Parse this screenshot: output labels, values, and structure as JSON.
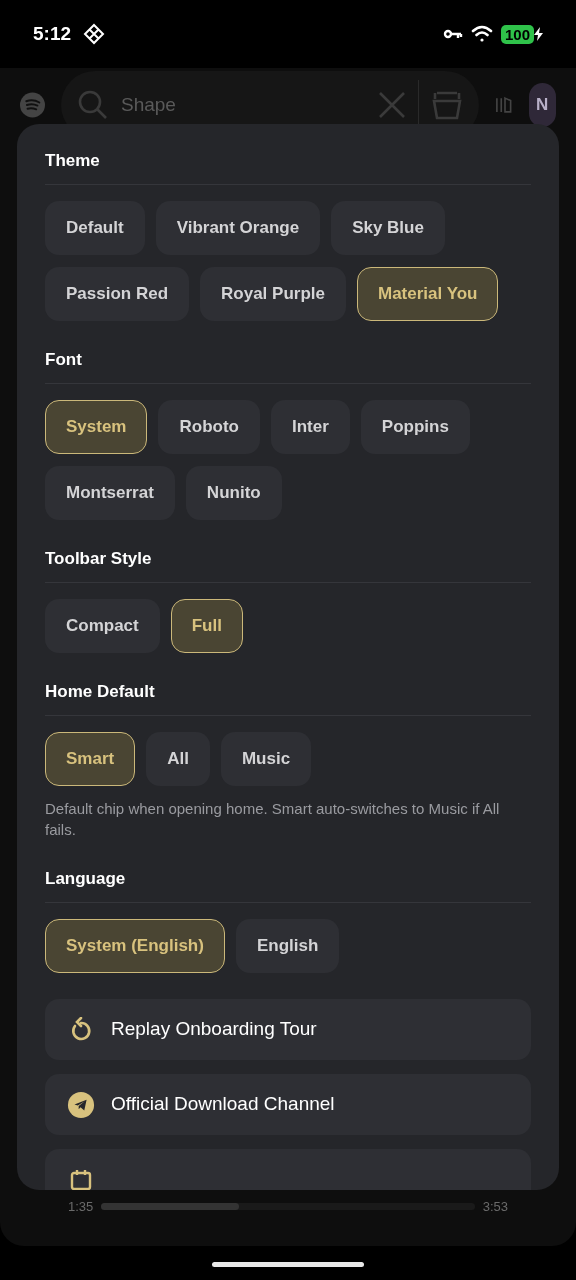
{
  "status_bar": {
    "time": "5:12",
    "battery": "100"
  },
  "top_bar": {
    "search": {
      "placeholder": "Shape"
    },
    "avatar": "N"
  },
  "player": {
    "elapsed": "1:35",
    "total": "3:53",
    "level": 0.37
  },
  "sections": [
    {
      "title": "Theme",
      "chips": [
        {
          "label": "Default",
          "selected": false
        },
        {
          "label": "Vibrant Orange",
          "selected": false
        },
        {
          "label": "Sky Blue",
          "selected": false
        },
        {
          "label": "Passion Red",
          "selected": false
        },
        {
          "label": "Royal Purple",
          "selected": false
        },
        {
          "label": "Material You",
          "selected": true
        }
      ]
    },
    {
      "title": "Font",
      "chips": [
        {
          "label": "System",
          "selected": true
        },
        {
          "label": "Roboto",
          "selected": false
        },
        {
          "label": "Inter",
          "selected": false
        },
        {
          "label": "Poppins",
          "selected": false
        },
        {
          "label": "Montserrat",
          "selected": false
        },
        {
          "label": "Nunito",
          "selected": false
        }
      ]
    },
    {
      "title": "Toolbar Style",
      "chips": [
        {
          "label": "Compact",
          "selected": false
        },
        {
          "label": "Full",
          "selected": true
        }
      ]
    },
    {
      "title": "Home Default",
      "chips": [
        {
          "label": "Smart",
          "selected": true
        },
        {
          "label": "All",
          "selected": false
        },
        {
          "label": "Music",
          "selected": false
        }
      ],
      "note": "Default chip when opening home. Smart auto-switches to Music if All fails."
    },
    {
      "title": "Language",
      "chips": [
        {
          "label": "System (English)",
          "selected": true
        },
        {
          "label": "English",
          "selected": false
        }
      ]
    }
  ],
  "actions": [
    {
      "kind": "tour",
      "label": "Replay Onboarding Tour"
    },
    {
      "kind": "channel",
      "label": "Official Download Channel"
    },
    {
      "kind": "schedule"
    }
  ]
}
